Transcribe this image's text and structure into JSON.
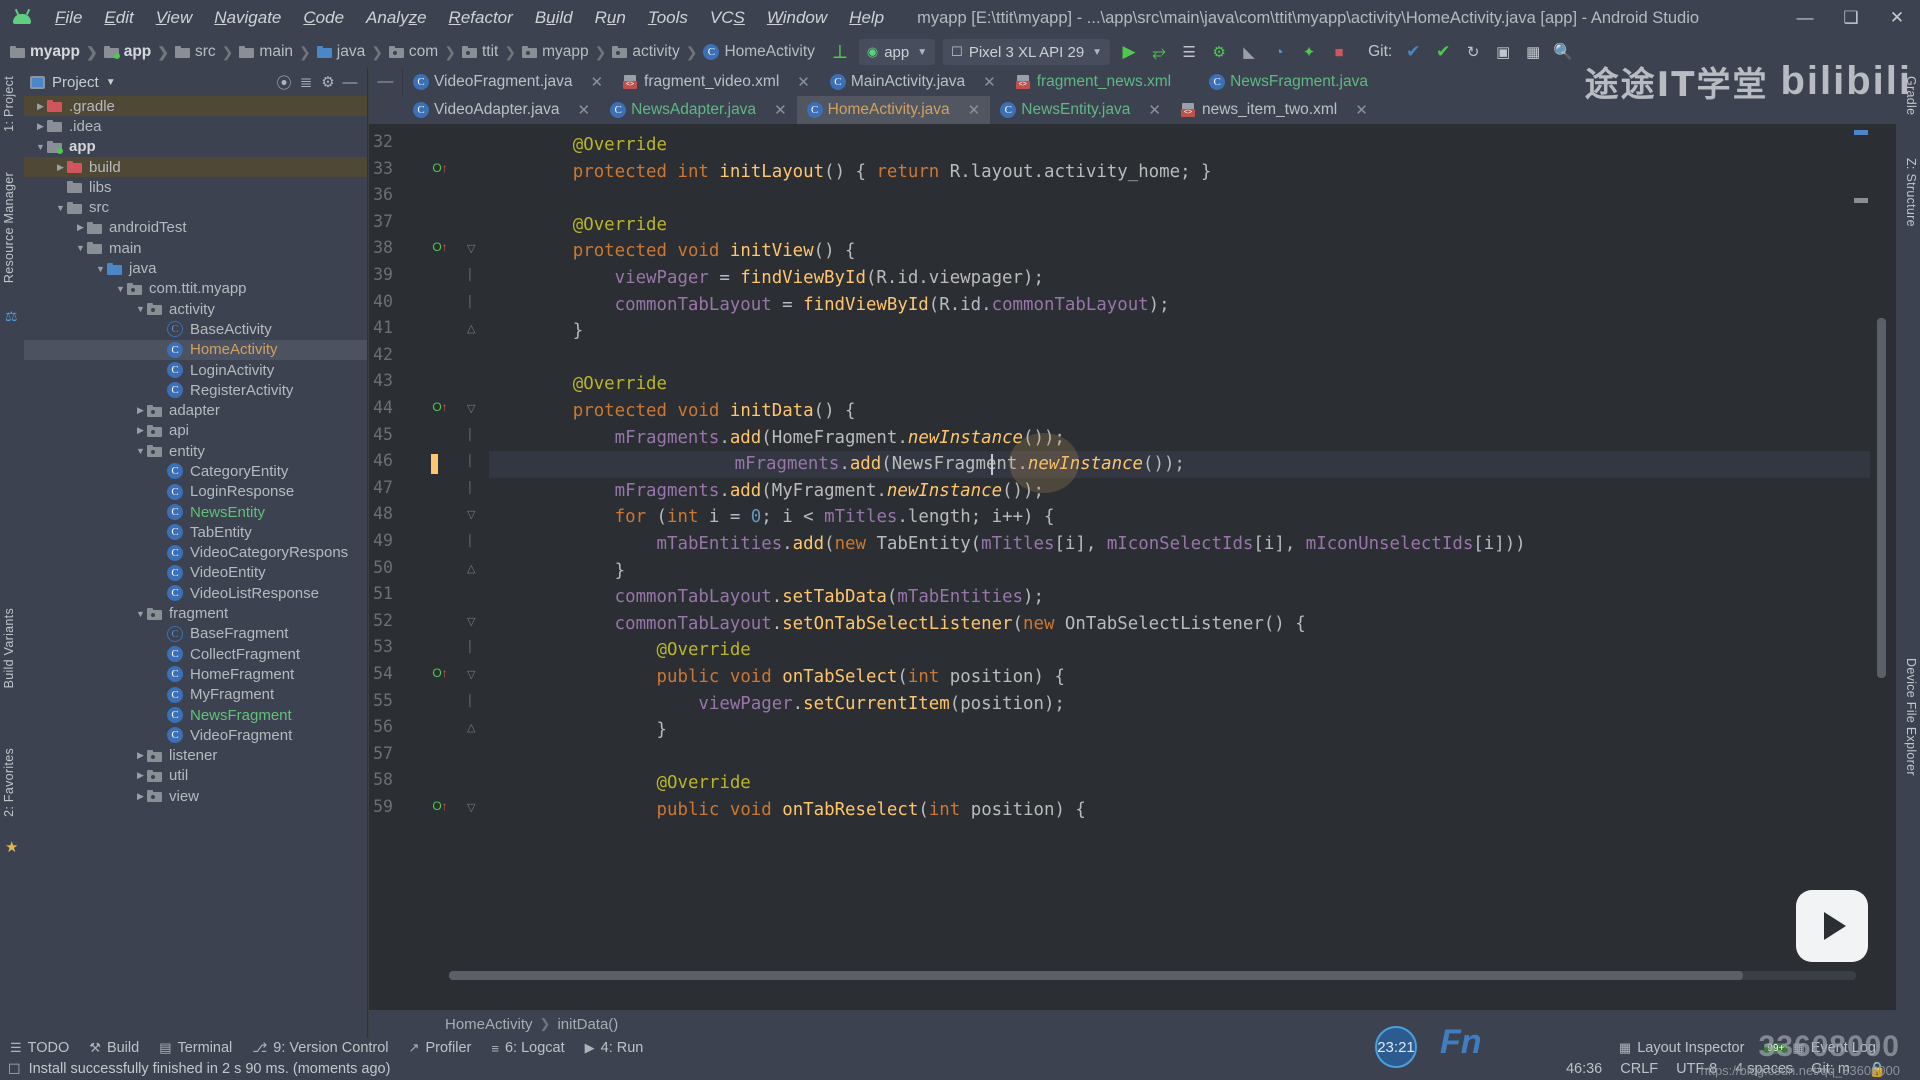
{
  "app": {
    "name": "Android Studio",
    "logo_icon": "android-robot-icon"
  },
  "titlebar": {
    "title": "myapp [E:\\ttit\\myapp] - ...\\app\\src\\main\\java\\com\\ttit\\myapp\\activity\\HomeActivity.java [app] - Android Studio",
    "menus": [
      "File",
      "Edit",
      "View",
      "Navigate",
      "Code",
      "Analyze",
      "Refactor",
      "Build",
      "Run",
      "Tools",
      "VCS",
      "Window",
      "Help"
    ],
    "window_controls": [
      {
        "name": "minimize",
        "glyph": "—"
      },
      {
        "name": "maximize",
        "glyph": "❐"
      },
      {
        "name": "close",
        "glyph": "✕"
      }
    ]
  },
  "navbar": {
    "breadcrumbs": [
      {
        "label": "myapp",
        "icon": "folder-module-icon",
        "bold": true
      },
      {
        "label": "app",
        "icon": "folder-module-green-icon",
        "bold": true
      },
      {
        "label": "src",
        "icon": "folder-icon",
        "bold": false
      },
      {
        "label": "main",
        "icon": "folder-icon",
        "bold": false
      },
      {
        "label": "java",
        "icon": "folder-source-blue-icon",
        "bold": false
      },
      {
        "label": "com",
        "icon": "package-icon",
        "bold": false
      },
      {
        "label": "ttit",
        "icon": "package-icon",
        "bold": false
      },
      {
        "label": "myapp",
        "icon": "package-icon",
        "bold": false
      },
      {
        "label": "activity",
        "icon": "package-icon",
        "bold": false
      },
      {
        "label": "HomeActivity",
        "icon": "java-class-icon",
        "bold": false
      }
    ],
    "module_selector": "app",
    "device_selector": "Pixel 3 XL API 29",
    "git_label": "Git:",
    "toolbar_icons": [
      "sync-project-icon",
      "run-icon",
      "debug-icon",
      "apply-changes-icon",
      "apply-code-changes-icon",
      "attach-debugger-icon",
      "profiler-icon",
      "coverage-icon",
      "stop-icon",
      "update-project-icon",
      "commit-icon",
      "avd-manager-icon",
      "sdk-manager-icon",
      "search-icon"
    ]
  },
  "left_toolwindows": [
    {
      "label": "1: Project",
      "name": "project"
    },
    {
      "label": "Resource Manager",
      "name": "resource-manager"
    },
    {
      "label": "Build Variants",
      "name": "build-variants"
    },
    {
      "label": "2: Favorites",
      "name": "favorites"
    }
  ],
  "right_toolwindows": [
    {
      "label": "Gradle",
      "name": "gradle"
    },
    {
      "label": "Z: Structure",
      "name": "structure"
    },
    {
      "label": "Device File Explorer",
      "name": "device-file-explorer"
    }
  ],
  "project_panel": {
    "title": "Project",
    "header_icons": [
      "locate-icon",
      "collapse-all-icon",
      "settings-gear-icon",
      "hide-icon"
    ],
    "tree": [
      {
        "label": ".gradle",
        "depth": 1,
        "arrow": "collapsed",
        "icon": "folder-red",
        "state": "highlight"
      },
      {
        "label": ".idea",
        "depth": 1,
        "arrow": "collapsed",
        "icon": "folder",
        "state": ""
      },
      {
        "label": "app",
        "depth": 1,
        "arrow": "expanded",
        "icon": "folder-green-dot",
        "state": "",
        "bold": true
      },
      {
        "label": "build",
        "depth": 2,
        "arrow": "collapsed",
        "icon": "folder-red",
        "state": "highlight"
      },
      {
        "label": "libs",
        "depth": 2,
        "arrow": "none",
        "icon": "folder",
        "state": ""
      },
      {
        "label": "src",
        "depth": 2,
        "arrow": "expanded",
        "icon": "folder",
        "state": ""
      },
      {
        "label": "androidTest",
        "depth": 3,
        "arrow": "collapsed",
        "icon": "folder",
        "state": ""
      },
      {
        "label": "main",
        "depth": 3,
        "arrow": "expanded",
        "icon": "folder",
        "state": ""
      },
      {
        "label": "java",
        "depth": 4,
        "arrow": "expanded",
        "icon": "folder-blue",
        "state": ""
      },
      {
        "label": "com.ttit.myapp",
        "depth": 5,
        "arrow": "expanded",
        "icon": "package",
        "state": ""
      },
      {
        "label": "activity",
        "depth": 6,
        "arrow": "expanded",
        "icon": "package",
        "state": ""
      },
      {
        "label": "BaseActivity",
        "depth": 7,
        "arrow": "none",
        "icon": "class-abstract",
        "state": ""
      },
      {
        "label": "HomeActivity",
        "depth": 7,
        "arrow": "none",
        "icon": "class",
        "state": "selected",
        "color": "orange"
      },
      {
        "label": "LoginActivity",
        "depth": 7,
        "arrow": "none",
        "icon": "class",
        "state": ""
      },
      {
        "label": "RegisterActivity",
        "depth": 7,
        "arrow": "none",
        "icon": "class",
        "state": ""
      },
      {
        "label": "adapter",
        "depth": 6,
        "arrow": "collapsed",
        "icon": "package",
        "state": ""
      },
      {
        "label": "api",
        "depth": 6,
        "arrow": "collapsed",
        "icon": "package",
        "state": ""
      },
      {
        "label": "entity",
        "depth": 6,
        "arrow": "expanded",
        "icon": "package",
        "state": ""
      },
      {
        "label": "CategoryEntity",
        "depth": 7,
        "arrow": "none",
        "icon": "class",
        "state": ""
      },
      {
        "label": "LoginResponse",
        "depth": 7,
        "arrow": "none",
        "icon": "class",
        "state": ""
      },
      {
        "label": "NewsEntity",
        "depth": 7,
        "arrow": "none",
        "icon": "class",
        "state": "",
        "color": "green"
      },
      {
        "label": "TabEntity",
        "depth": 7,
        "arrow": "none",
        "icon": "class",
        "state": ""
      },
      {
        "label": "VideoCategoryRespons",
        "depth": 7,
        "arrow": "none",
        "icon": "class",
        "state": ""
      },
      {
        "label": "VideoEntity",
        "depth": 7,
        "arrow": "none",
        "icon": "class",
        "state": ""
      },
      {
        "label": "VideoListResponse",
        "depth": 7,
        "arrow": "none",
        "icon": "class",
        "state": ""
      },
      {
        "label": "fragment",
        "depth": 6,
        "arrow": "expanded",
        "icon": "package",
        "state": ""
      },
      {
        "label": "BaseFragment",
        "depth": 7,
        "arrow": "none",
        "icon": "class-abstract",
        "state": ""
      },
      {
        "label": "CollectFragment",
        "depth": 7,
        "arrow": "none",
        "icon": "class",
        "state": ""
      },
      {
        "label": "HomeFragment",
        "depth": 7,
        "arrow": "none",
        "icon": "class",
        "state": ""
      },
      {
        "label": "MyFragment",
        "depth": 7,
        "arrow": "none",
        "icon": "class",
        "state": ""
      },
      {
        "label": "NewsFragment",
        "depth": 7,
        "arrow": "none",
        "icon": "class",
        "state": "",
        "color": "green"
      },
      {
        "label": "VideoFragment",
        "depth": 7,
        "arrow": "none",
        "icon": "class",
        "state": ""
      },
      {
        "label": "listener",
        "depth": 6,
        "arrow": "collapsed",
        "icon": "package",
        "state": ""
      },
      {
        "label": "util",
        "depth": 6,
        "arrow": "collapsed",
        "icon": "package",
        "state": ""
      },
      {
        "label": "view",
        "depth": 6,
        "arrow": "collapsed",
        "icon": "package",
        "state": ""
      }
    ]
  },
  "editor": {
    "tabs_row1": [
      {
        "label": "VideoFragment.java",
        "icon": "java-class-icon",
        "active": false,
        "closable": true,
        "color": ""
      },
      {
        "label": "fragment_video.xml",
        "icon": "xml-layout-icon",
        "active": false,
        "closable": true,
        "color": ""
      },
      {
        "label": "MainActivity.java",
        "icon": "java-class-icon",
        "active": false,
        "closable": true,
        "color": ""
      },
      {
        "label": "fragment_news.xml",
        "icon": "xml-layout-icon",
        "active": false,
        "closable": false,
        "color": "green"
      },
      {
        "label": "NewsFragment.java",
        "icon": "java-class-icon",
        "active": false,
        "closable": false,
        "color": "green"
      }
    ],
    "tabs_row2": [
      {
        "label": "VideoAdapter.java",
        "icon": "java-class-icon",
        "active": false,
        "closable": true,
        "color": ""
      },
      {
        "label": "NewsAdapter.java",
        "icon": "java-class-icon",
        "active": false,
        "closable": true,
        "color": "green"
      },
      {
        "label": "HomeActivity.java",
        "icon": "java-class-icon",
        "active": true,
        "closable": true,
        "color": "orange"
      },
      {
        "label": "NewsEntity.java",
        "icon": "java-class-icon",
        "active": false,
        "closable": true,
        "color": "green"
      },
      {
        "label": "news_item_two.xml",
        "icon": "xml-layout-icon",
        "active": false,
        "closable": true,
        "color": ""
      }
    ],
    "pin_button": "—",
    "breadcrumb_bottom": [
      "HomeActivity",
      "initData()"
    ],
    "first_visible_line": 32,
    "current_line": 46,
    "lines": [
      {
        "n": 32,
        "marker": "",
        "fold": "",
        "text": "        @Override"
      },
      {
        "n": 33,
        "marker": "oi",
        "fold": "",
        "text": "        protected int initLayout() { return R.layout.activity_home; }"
      },
      {
        "n": 36,
        "marker": "",
        "fold": "",
        "text": ""
      },
      {
        "n": 37,
        "marker": "",
        "fold": "",
        "text": "        @Override"
      },
      {
        "n": 38,
        "marker": "oi",
        "fold": "t",
        "text": "        protected void initView() {"
      },
      {
        "n": 39,
        "marker": "",
        "fold": "|",
        "text": "            viewPager = findViewById(R.id.viewpager);"
      },
      {
        "n": 40,
        "marker": "",
        "fold": "|",
        "text": "            commonTabLayout = findViewById(R.id.commonTabLayout);"
      },
      {
        "n": 41,
        "marker": "",
        "fold": "b",
        "text": "        }"
      },
      {
        "n": 42,
        "marker": "",
        "fold": "",
        "text": ""
      },
      {
        "n": 43,
        "marker": "",
        "fold": "",
        "text": "        @Override"
      },
      {
        "n": 44,
        "marker": "oi",
        "fold": "t",
        "text": "        protected void initData() {"
      },
      {
        "n": 45,
        "marker": "",
        "fold": "|",
        "text": "            mFragments.add(HomeFragment.newInstance());"
      },
      {
        "n": 46,
        "marker": "",
        "fold": "|",
        "text": "            mFragments.add(NewsFragment.newInstance());"
      },
      {
        "n": 47,
        "marker": "",
        "fold": "|",
        "text": "            mFragments.add(MyFragment.newInstance());"
      },
      {
        "n": 48,
        "marker": "",
        "fold": "t",
        "text": "            for (int i = 0; i < mTitles.length; i++) {"
      },
      {
        "n": 49,
        "marker": "",
        "fold": "|",
        "text": "                mTabEntities.add(new TabEntity(mTitles[i], mIconSelectIds[i], mIconUnselectIds[i]))"
      },
      {
        "n": 50,
        "marker": "",
        "fold": "b",
        "text": "            }"
      },
      {
        "n": 51,
        "marker": "",
        "fold": "",
        "text": "            commonTabLayout.setTabData(mTabEntities);"
      },
      {
        "n": 52,
        "marker": "",
        "fold": "t",
        "text": "            commonTabLayout.setOnTabSelectListener(new OnTabSelectListener() {"
      },
      {
        "n": 53,
        "marker": "",
        "fold": "|",
        "text": "                @Override"
      },
      {
        "n": 54,
        "marker": "oi",
        "fold": "t",
        "text": "                public void onTabSelect(int position) {"
      },
      {
        "n": 55,
        "marker": "",
        "fold": "|",
        "text": "                    viewPager.setCurrentItem(position);"
      },
      {
        "n": 56,
        "marker": "",
        "fold": "b",
        "text": "                }"
      },
      {
        "n": 57,
        "marker": "",
        "fold": "",
        "text": ""
      },
      {
        "n": 58,
        "marker": "",
        "fold": "",
        "text": "                @Override"
      },
      {
        "n": 59,
        "marker": "oi",
        "fold": "t",
        "text": "                public void onTabReselect(int position) {"
      }
    ]
  },
  "bottom_toolwindows": [
    {
      "label": "TODO",
      "icon": "todo-icon"
    },
    {
      "label": "Build",
      "icon": "build-hammer-icon"
    },
    {
      "label": "Terminal",
      "icon": "terminal-icon"
    },
    {
      "label": "9: Version Control",
      "icon": "version-control-icon"
    },
    {
      "label": "Profiler",
      "icon": "profiler-icon"
    },
    {
      "label": "6: Logcat",
      "icon": "logcat-icon"
    },
    {
      "label": "4: Run",
      "icon": "run-icon"
    }
  ],
  "bottom_right_toolwindows": [
    {
      "label": "Layout Inspector",
      "icon": "layout-inspector-icon"
    },
    {
      "label": "Event Log",
      "icon": "event-log-icon",
      "badge": "99+"
    }
  ],
  "statusbar": {
    "message": "Install successfully finished in 2 s 90 ms. (moments ago)",
    "caret_position": "46:36",
    "line_separator": "CRLF",
    "encoding": "UTF-8",
    "indent": "4 spaces",
    "git_branch": "Git: m"
  },
  "overlays": {
    "clock_badge": "23:21",
    "watermark_brand": "途途IT学堂",
    "watermark_site": "bilibili",
    "watermark_fn": "Fn",
    "watermark_csdn": "https://blog.csdn.net/qq_33608000",
    "watermark_number": "33608000"
  },
  "colors": {
    "accent_orange": "#d2a15e",
    "accent_green": "#62c07a",
    "accent_blue": "#3b6fb6",
    "editor_bg": "#2b2e33",
    "panel_bg": "#3c4250",
    "selection": "#4c5260",
    "highlight": "#4e4835"
  }
}
